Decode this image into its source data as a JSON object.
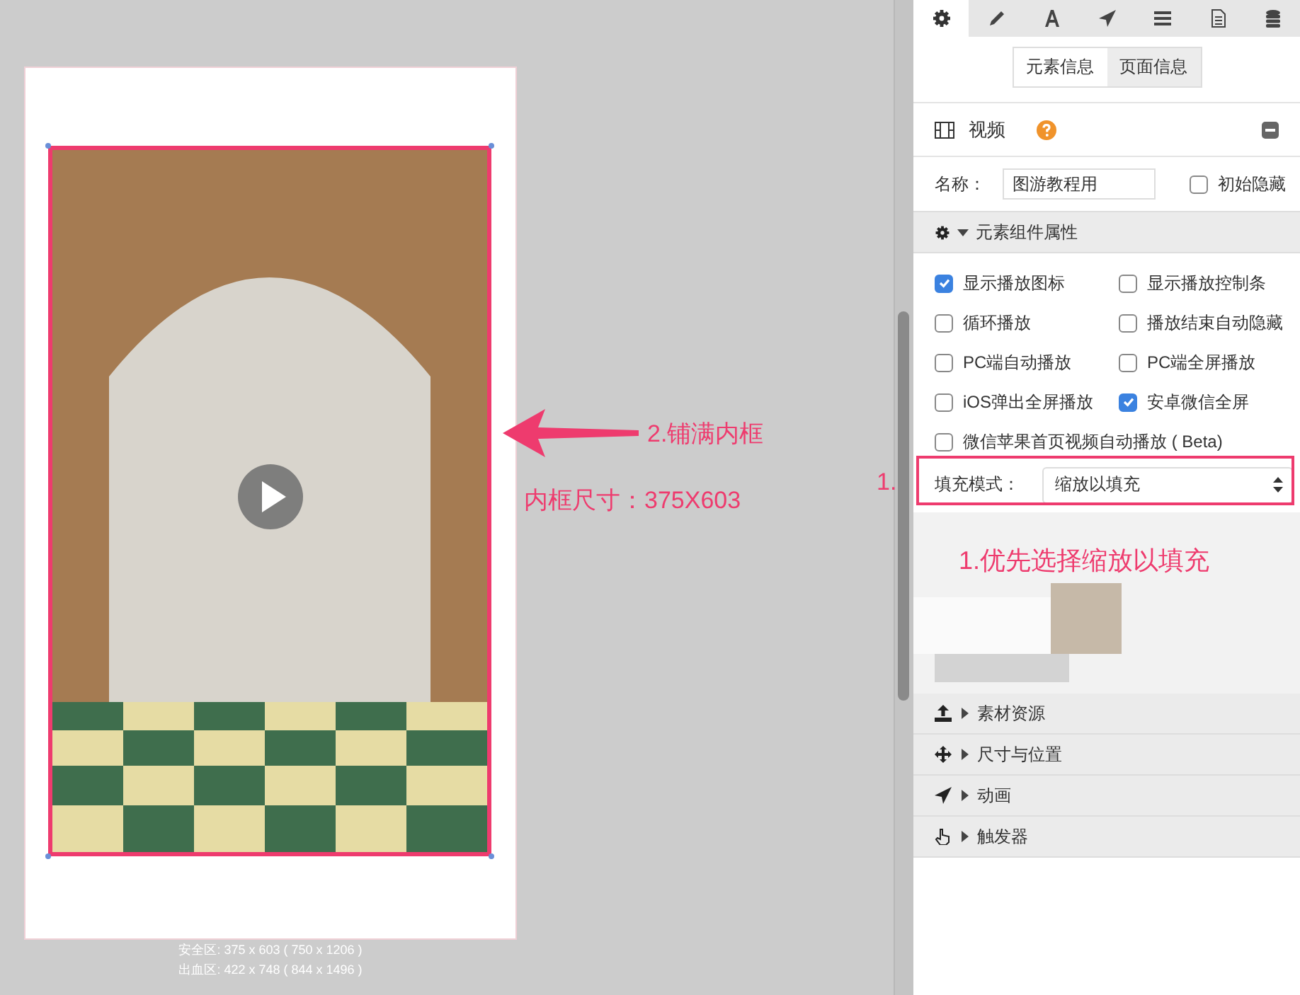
{
  "canvas": {
    "video": {
      "selected": true
    },
    "safe_area": "安全区: 375 x 603 ( 750 x 1206 )",
    "bleed_area": "出血区: 422 x 748 ( 844 x 1496 )"
  },
  "annotations": {
    "arrow_label": "2.铺满内框",
    "size_note": "内框尺寸：375X603",
    "step_marker": "1.",
    "tip": "1.优先选择缩放以填充"
  },
  "panel": {
    "tabs": [
      {
        "selected": true
      },
      {
        "selected": false
      },
      {
        "selected": false
      },
      {
        "selected": false
      },
      {
        "selected": false
      },
      {
        "selected": false
      },
      {
        "selected": false
      }
    ],
    "info_toggle": [
      {
        "label": "元素信息",
        "selected": true
      },
      {
        "label": "页面信息",
        "selected": false
      }
    ],
    "element_type": "视频",
    "name_field": {
      "label": "名称：",
      "value": "图游教程用"
    },
    "hidden_option": {
      "label": "初始隐藏",
      "checked": false
    },
    "properties": {
      "title": "元素组件属性",
      "expanded": true,
      "options": [
        {
          "label": "显示播放图标",
          "checked": true
        },
        {
          "label": "显示播放控制条",
          "checked": false
        },
        {
          "label": "循环播放",
          "checked": false
        },
        {
          "label": "播放结束自动隐藏",
          "checked": false
        },
        {
          "label": "PC端自动播放",
          "checked": false
        },
        {
          "label": "PC端全屏播放",
          "checked": false
        },
        {
          "label": "iOS弹出全屏播放",
          "checked": false
        },
        {
          "label": "安卓微信全屏",
          "checked": true
        },
        {
          "label": "微信苹果首页视频自动播放 ( Beta)",
          "checked": false
        }
      ],
      "fill_mode": {
        "label": "填充模式：",
        "value": "缩放以填充"
      }
    },
    "sections": [
      {
        "title": "素材资源",
        "expanded": false
      },
      {
        "title": "尺寸与位置",
        "expanded": false
      },
      {
        "title": "动画",
        "expanded": false
      },
      {
        "title": "触发器",
        "expanded": false
      }
    ]
  }
}
